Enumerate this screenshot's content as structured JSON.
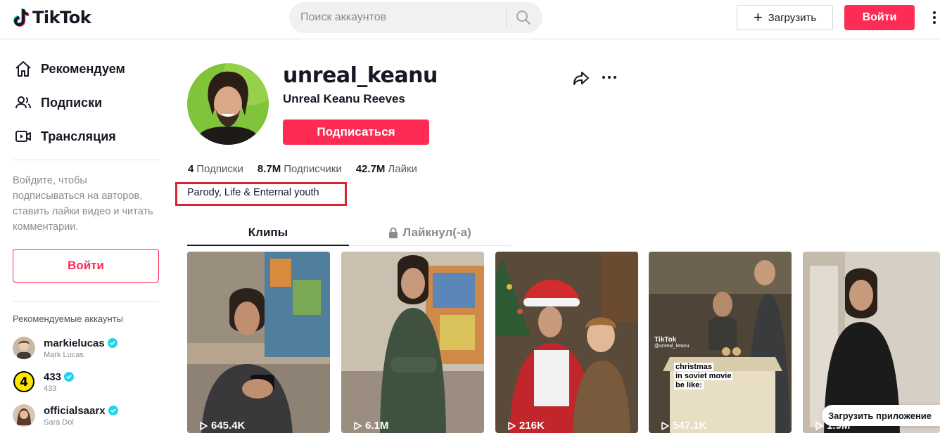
{
  "header": {
    "logo_text": "TikTok",
    "search_placeholder": "Поиск аккаунтов",
    "upload_label": "Загрузить",
    "login_label": "Войти"
  },
  "sidebar": {
    "nav": [
      {
        "label": "Рекомендуем",
        "icon": "home-icon"
      },
      {
        "label": "Подписки",
        "icon": "users-icon"
      },
      {
        "label": "Трансляция",
        "icon": "live-icon"
      }
    ],
    "login_prompt": "Войдите, чтобы подписываться на авторов, ставить лайки видео и читать комментарии.",
    "login_button": "Войти",
    "recommended_title": "Рекомендуемые аккаунты",
    "accounts": [
      {
        "username": "markielucas",
        "name": "Mark Lucas",
        "verified": true
      },
      {
        "username": "433",
        "name": "433",
        "verified": true
      },
      {
        "username": "officialsaarx",
        "name": "Sara Dol",
        "verified": true
      }
    ]
  },
  "profile": {
    "username": "unreal_keanu",
    "display_name": "Unreal Keanu Reeves",
    "follow_label": "Подписаться",
    "stats": [
      {
        "value": "4",
        "label": "Подписки"
      },
      {
        "value": "8.7M",
        "label": "Подписчики"
      },
      {
        "value": "42.7M",
        "label": "Лайки"
      }
    ],
    "bio": "Parody, Life & Enternal youth",
    "highlight_color": "#d7262f"
  },
  "tabs": [
    {
      "label": "Клипы",
      "active": true
    },
    {
      "label": "Лайкнул(-а)",
      "active": false,
      "locked": true
    }
  ],
  "videos": [
    {
      "views": "645.4K"
    },
    {
      "views": "6.1M"
    },
    {
      "views": "216K"
    },
    {
      "views": "547.1K",
      "caption_lines": [
        "christmas",
        "in soviet movie",
        "be like:"
      ],
      "watermark": "TikTok",
      "watermark_handle": "@unreal_keanu"
    },
    {
      "views": "1.9M"
    }
  ],
  "get_app_label": "Загрузить приложение",
  "colors": {
    "accent": "#fe2c55",
    "text": "#161823",
    "muted": "#8a8b91",
    "verified": "#20d5ec"
  }
}
